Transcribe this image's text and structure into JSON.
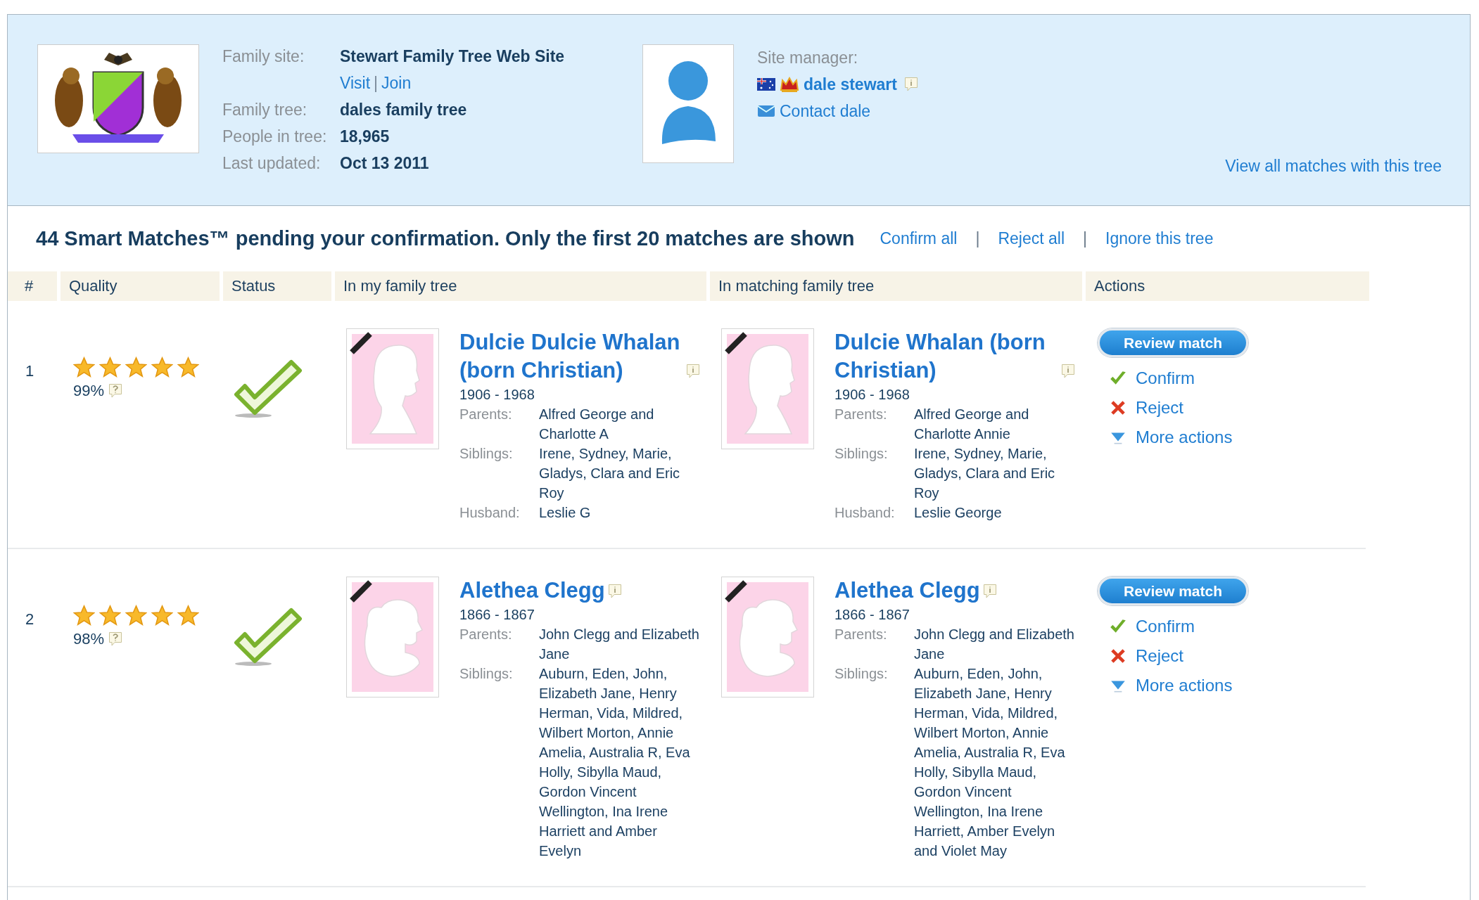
{
  "site": {
    "family_site_label": "Family site:",
    "family_site": "Stewart Family Tree Web Site",
    "links": [
      "Visit",
      "Join"
    ],
    "link_separator": "|",
    "family_tree_label": "Family tree:",
    "family_tree": "dales family tree",
    "people_label": "People in tree:",
    "people": "18,965",
    "updated_label": "Last updated:",
    "updated": "Oct 13 2011"
  },
  "manager": {
    "label": "Site manager:",
    "name": "dale stewart",
    "contact": "Contact dale"
  },
  "view_all": "View all matches with this tree",
  "summary": {
    "title": "44 Smart Matches™ pending your confirmation. Only the first 20 matches are shown",
    "actions": [
      "Confirm all",
      "Reject all",
      "Ignore this tree"
    ],
    "separator": "|"
  },
  "table": {
    "columns": [
      "#",
      "Quality",
      "Status",
      "In my family tree",
      "In matching family tree",
      "Actions"
    ],
    "rows": [
      {
        "number": "1",
        "stars": 5,
        "quality": "99%",
        "confirmed": true,
        "mine": {
          "name": "Dulcie Dulcie Whalan (born Christian)",
          "deceased": true,
          "kind": "woman",
          "years": "1906 - 1968",
          "details": [
            {
              "label": "Parents:",
              "value": "Alfred George and Charlotte A"
            },
            {
              "label": "Siblings:",
              "value": "Irene, Sydney, Marie, Gladys, Clara and Eric Roy"
            },
            {
              "label": "Husband:",
              "value": "Leslie G"
            }
          ]
        },
        "matching": {
          "name": "Dulcie Whalan (born Christian)",
          "deceased": true,
          "kind": "woman",
          "years": "1906 - 1968",
          "details": [
            {
              "label": "Parents:",
              "value": "Alfred George and Charlotte Annie"
            },
            {
              "label": "Siblings:",
              "value": "Irene, Sydney, Marie, Gladys, Clara and Eric Roy"
            },
            {
              "label": "Husband:",
              "value": "Leslie George"
            }
          ]
        },
        "review": "Review match",
        "actions": [
          {
            "kind": "confirm",
            "label": "Confirm"
          },
          {
            "kind": "reject",
            "label": "Reject"
          },
          {
            "kind": "more",
            "label": "More actions"
          }
        ]
      },
      {
        "number": "2",
        "stars": 5,
        "quality": "98%",
        "confirmed": true,
        "mine": {
          "name": "Alethea Clegg",
          "deceased": true,
          "kind": "girl",
          "years": "1866 - 1867",
          "details": [
            {
              "label": "Parents:",
              "value": "John Clegg and Elizabeth Jane"
            },
            {
              "label": "Siblings:",
              "value": "Auburn, Eden, John, Elizabeth Jane, Henry Herman, Vida, Mildred, Wilbert Morton, Annie Amelia, Australia R, Eva Holly, Sibylla Maud, Gordon Vincent Wellington, Ina Irene Harriett and Amber Evelyn"
            }
          ]
        },
        "matching": {
          "name": "Alethea Clegg",
          "deceased": true,
          "kind": "girl",
          "years": "1866 - 1867",
          "details": [
            {
              "label": "Parents:",
              "value": "John Clegg and Elizabeth Jane"
            },
            {
              "label": "Siblings:",
              "value": "Auburn, Eden, John, Elizabeth Jane, Henry Herman, Vida, Mildred, Wilbert Morton, Annie Amelia, Australia R, Eva Holly, Sibylla Maud, Gordon Vincent Wellington, Ina Irene Harriett, Amber Evelyn and Violet May"
            }
          ]
        },
        "review": "Review match",
        "actions": [
          {
            "kind": "confirm",
            "label": "Confirm"
          },
          {
            "kind": "reject",
            "label": "Reject"
          },
          {
            "kind": "more",
            "label": "More actions"
          }
        ]
      }
    ]
  }
}
